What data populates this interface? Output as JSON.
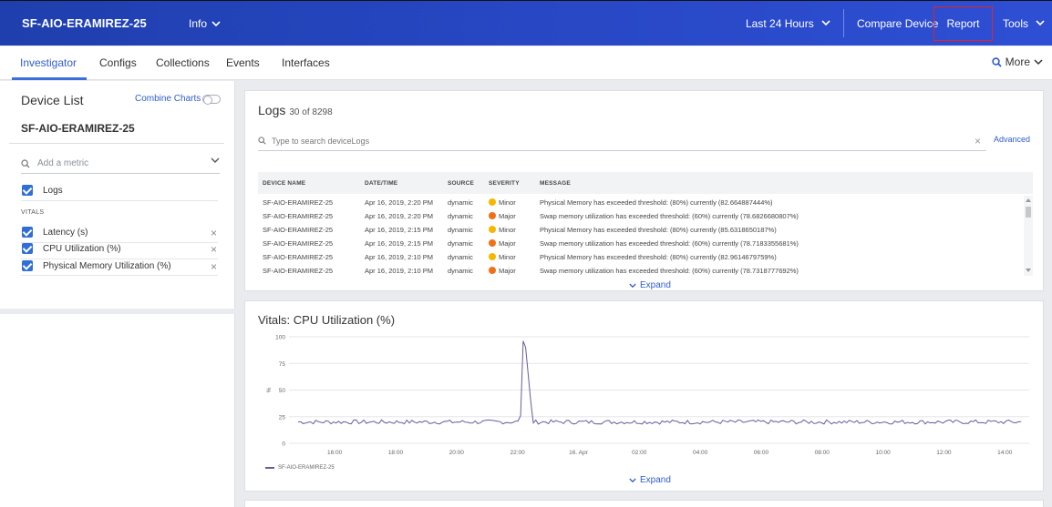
{
  "header": {
    "device_title": "SF-AIO-ERAMIREZ-25",
    "info_label": "Info",
    "time_range": "Last 24 Hours",
    "compare_label": "Compare Device",
    "report_label": "Report",
    "tools_label": "Tools"
  },
  "tabs": [
    {
      "label": "Investigator"
    },
    {
      "label": "Configs"
    },
    {
      "label": "Collections"
    },
    {
      "label": "Events"
    },
    {
      "label": "Interfaces"
    }
  ],
  "more_label": "More",
  "sidebar": {
    "title": "Device List",
    "combine_charts": "Combine Charts",
    "device_name": "SF-AIO-ERAMIREZ-25",
    "metric_placeholder": "Add a metric",
    "logs_label": "Logs",
    "vitals_label": "VITALS",
    "vitals": [
      {
        "label": "Latency (s)"
      },
      {
        "label": "CPU Utilization (%)"
      },
      {
        "label": "Physical Memory Utilization (%)"
      }
    ]
  },
  "logs": {
    "title": "Logs",
    "count": "30 of 8298",
    "search_placeholder": "Type to search deviceLogs",
    "advanced": "Advanced",
    "columns": [
      "DEVICE NAME",
      "DATE/TIME",
      "SOURCE",
      "SEVERITY",
      "MESSAGE"
    ],
    "rows": [
      {
        "device": "SF-AIO-ERAMIREZ-25",
        "datetime": "Apr 16, 2019, 2:20 PM",
        "source": "dynamic",
        "severity": "Minor",
        "message": "Physical Memory has exceeded threshold: (80%) currently (82.664887444%)"
      },
      {
        "device": "SF-AIO-ERAMIREZ-25",
        "datetime": "Apr 16, 2019, 2:20 PM",
        "source": "dynamic",
        "severity": "Major",
        "message": "Swap memory utilization has exceeded threshold: (60%) currently (78.6826680807%)"
      },
      {
        "device": "SF-AIO-ERAMIREZ-25",
        "datetime": "Apr 16, 2019, 2:15 PM",
        "source": "dynamic",
        "severity": "Minor",
        "message": "Physical Memory has exceeded threshold: (80%) currently (85.6318650187%)"
      },
      {
        "device": "SF-AIO-ERAMIREZ-25",
        "datetime": "Apr 16, 2019, 2:15 PM",
        "source": "dynamic",
        "severity": "Major",
        "message": "Swap memory utilization has exceeded threshold: (60%) currently (78.7183355681%)"
      },
      {
        "device": "SF-AIO-ERAMIREZ-25",
        "datetime": "Apr 16, 2019, 2:10 PM",
        "source": "dynamic",
        "severity": "Minor",
        "message": "Physical Memory has exceeded threshold: (80%) currently (82.9614679759%)"
      },
      {
        "device": "SF-AIO-ERAMIREZ-25",
        "datetime": "Apr 16, 2019, 2:10 PM",
        "source": "dynamic",
        "severity": "Major",
        "message": "Swap memory utilization has exceeded threshold: (60%) currently (78.7318777692%)"
      }
    ],
    "expand": "Expand"
  },
  "severity_colors": {
    "Minor": "#f5b800",
    "Major": "#f07018"
  },
  "chart_expand": "Expand",
  "chart_data": {
    "type": "line",
    "title": "Vitals: CPU Utilization (%)",
    "ylabel": "%",
    "ylim": [
      0,
      100
    ],
    "yticks": [
      0,
      25,
      50,
      75,
      100
    ],
    "xticks": [
      "16:00",
      "18:00",
      "20:00",
      "22:00",
      "16. Apr",
      "02:00",
      "04:00",
      "06:00",
      "08:00",
      "10:00",
      "12:00",
      "14:00"
    ],
    "xlim_hours": [
      14.5,
      38.8
    ],
    "series": [
      {
        "name": "SF-AIO-ERAMIREZ-25",
        "color": "#6b5a9e",
        "baseline": 20,
        "jitter": 2,
        "spike": {
          "start_hour": 22.1,
          "peak_hour": 22.15,
          "peak_end_hour": 22.25,
          "end_hour": 22.5,
          "peak": 96
        }
      }
    ]
  }
}
